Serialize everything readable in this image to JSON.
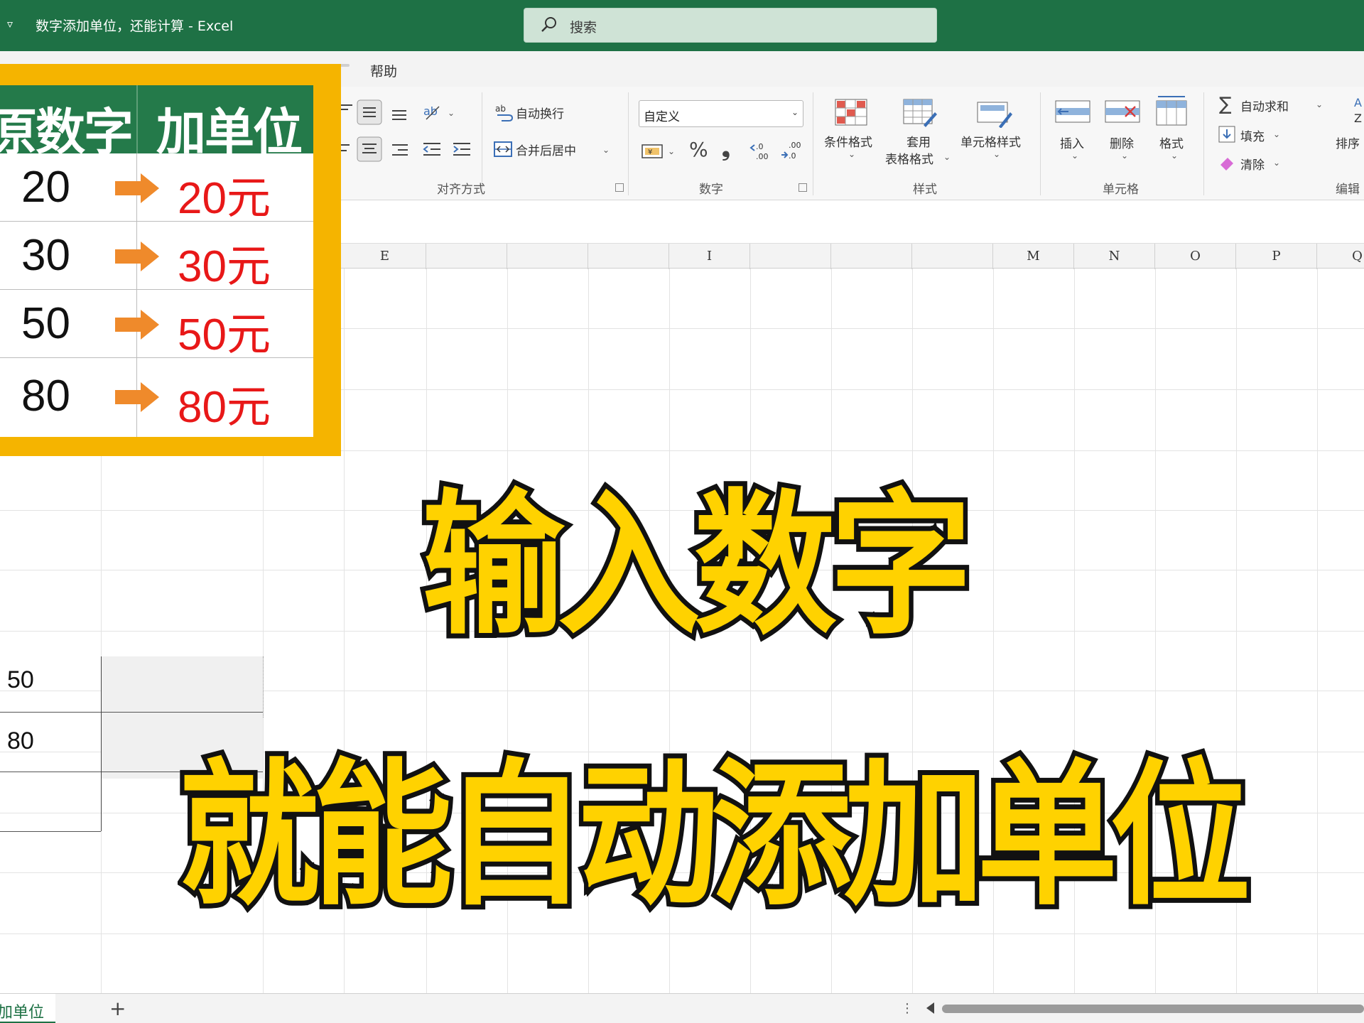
{
  "titlebar": {
    "qat_glyph": "▿",
    "doc_title": "数字添加单位，还能计算  -  Excel",
    "search_placeholder": "搜索"
  },
  "menu": {
    "help": "帮助"
  },
  "ribbon": {
    "alignment": {
      "wrap_text": "自动换行",
      "merge_center": "合并后居中",
      "group_label": "对齐方式"
    },
    "number": {
      "format_value": "自定义",
      "percent": "%",
      "comma": "❟",
      "group_label": "数字"
    },
    "styles": {
      "conditional": "条件格式",
      "table_line1": "套用",
      "table_line2": "表格格式",
      "cell_styles": "单元格样式",
      "group_label": "样式"
    },
    "cells": {
      "insert": "插入",
      "delete": "删除",
      "format": "格式",
      "group_label": "单元格"
    },
    "editing": {
      "autosum": "自动求和",
      "fill": "填充",
      "clear": "清除",
      "sort": "排序",
      "group_label": "编辑"
    }
  },
  "grid": {
    "columns": [
      "E",
      "I",
      "M",
      "N",
      "O",
      "P",
      "Q"
    ],
    "visible_cells": [
      "50",
      "80"
    ]
  },
  "inset": {
    "header_left": "原数字",
    "header_right": "加单位",
    "rows": [
      {
        "number": "20",
        "result": "20元"
      },
      {
        "number": "30",
        "result": "30元"
      },
      {
        "number": "50",
        "result": "50元"
      },
      {
        "number": "80",
        "result": "80元"
      }
    ],
    "border_color": "#f5b400",
    "header_color": "#247a4a",
    "arrow_color": "#ef8a2b",
    "result_color": "#e81818"
  },
  "captions": {
    "line1": "输入数字",
    "line2": "就能自动添加单位",
    "fill_color": "#ffd200"
  },
  "sheets": {
    "active_tab": "加单位",
    "add_label": "+"
  }
}
